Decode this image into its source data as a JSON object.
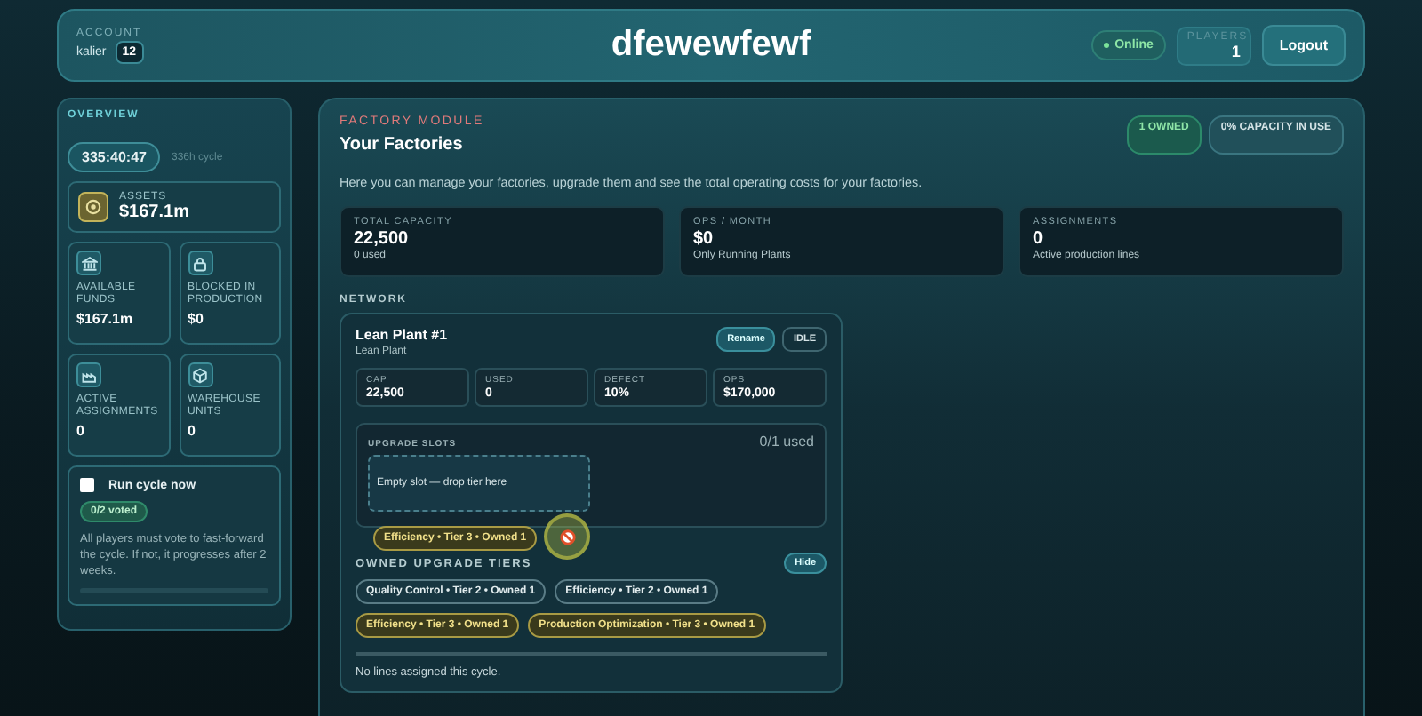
{
  "header": {
    "account_label": "ACCOUNT",
    "account_name": "kalier",
    "account_badge": "12",
    "title": "dfewewfewf",
    "status": {
      "label": "Online",
      "online": true
    },
    "players_label": "PLAYERS",
    "players": "1",
    "logout": "Logout"
  },
  "overview": {
    "title": "OVERVIEW",
    "timer": "335:40:47",
    "cycle": "336h cycle",
    "assets": {
      "label": "ASSETS",
      "value": "$167.1m"
    },
    "stats": [
      {
        "kind": "bank",
        "label": "AVAILABLE FUNDS",
        "value": "$167.1m"
      },
      {
        "kind": "lock",
        "label": "BLOCKED IN PRODUCTION",
        "value": "$0"
      },
      {
        "kind": "factory",
        "label": "ACTIVE ASSIGNMENTS",
        "value": "0"
      },
      {
        "kind": "box",
        "label": "WAREHOUSE UNITS",
        "value": "0"
      }
    ],
    "vote": {
      "label": "Run cycle now",
      "checked": false,
      "badge": "0/2 voted",
      "note": "All players must vote to fast-forward the cycle. If not, it progresses after 2 weeks.",
      "level": 0
    }
  },
  "factory": {
    "eyebrow": "FACTORY MODULE",
    "title": "Your Factories",
    "badges": [
      {
        "label": "1 OWNED",
        "kind": "success"
      },
      {
        "label": "0% CAPACITY IN USE",
        "kind": "neutral"
      }
    ],
    "intro": "Here you can manage your factories, upgrade them and see the total operating costs for your factories.",
    "summary": [
      {
        "label": "TOTAL CAPACITY",
        "value": "22,500",
        "sub": "0 used"
      },
      {
        "label": "OPS / MONTH",
        "value": "$0",
        "sub": "Only Running Plants"
      },
      {
        "label": "ASSIGNMENTS",
        "value": "0",
        "sub": "Active production lines"
      }
    ],
    "network_label": "NETWORK",
    "plant": {
      "name": "Lean Plant #1",
      "type": "Lean Plant",
      "rename": "Rename",
      "status": "IDLE",
      "specs": [
        {
          "label": "CAP",
          "value": "22,500"
        },
        {
          "label": "USED",
          "value": "0"
        },
        {
          "label": "DEFECT",
          "value": "10%"
        },
        {
          "label": "OPS",
          "value": "$170,000"
        }
      ],
      "slots": {
        "label": "UPGRADE SLOTS",
        "count": "0/1 used",
        "empty": "Empty slot — drop tier here"
      },
      "tiers": {
        "label": "OWNED UPGRADE TIERS",
        "hide": "Hide",
        "items": [
          {
            "label": "Quality Control • Tier 2 • Owned 1",
            "kind": "standard"
          },
          {
            "label": "Efficiency • Tier 2 • Owned 1",
            "kind": "standard"
          },
          {
            "label": "Efficiency • Tier 3 • Owned 1",
            "kind": "gold"
          },
          {
            "label": "Production Optimization • Tier 3 • Owned 1",
            "kind": "gold"
          }
        ],
        "dragging": {
          "label": "Efficiency • Tier 3 • Owned 1",
          "kind": "gold"
        }
      },
      "assignments_note": "No lines assigned this cycle."
    }
  }
}
